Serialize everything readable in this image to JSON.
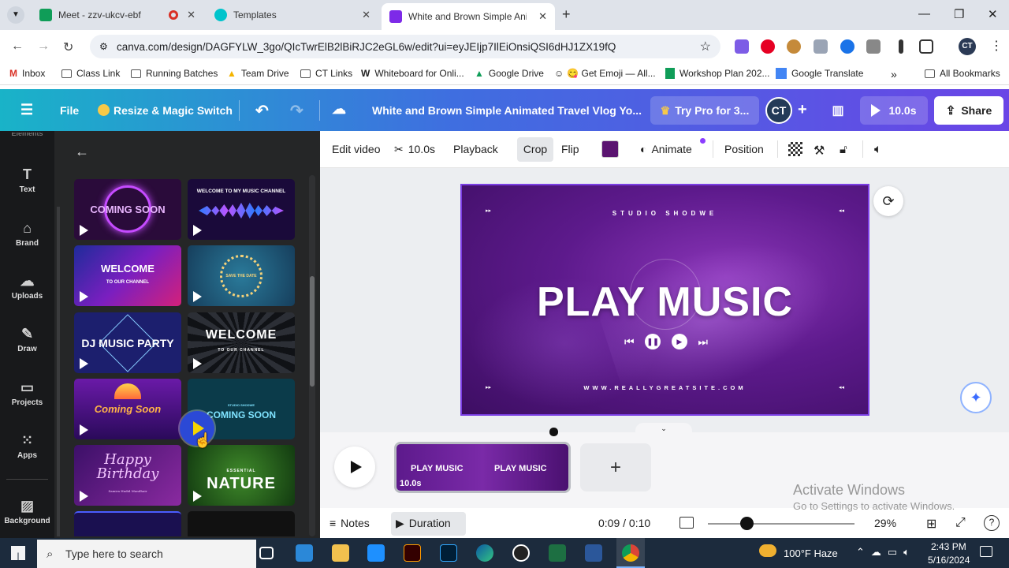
{
  "browser": {
    "tabs": [
      {
        "title": "Meet - zzv-ukcv-ebf",
        "favicon_color": "#0f9d58"
      },
      {
        "title": "Templates",
        "favicon_color": "#00c4cc"
      },
      {
        "title": "White and Brown Simple Anima",
        "favicon_color": "#7d2ae8"
      }
    ],
    "url": "canva.com/design/DAGFYLW_3go/QIcTwrElB2lBiRJC2eGL6w/edit?ui=eyJEIjp7IlEiOnsiQSI6dHJ1ZX19fQ",
    "profile": "CT",
    "bookmarks": [
      "Inbox",
      "Class Link",
      "Running Batches",
      "Team Drive",
      "CT Links",
      "Whiteboard for Onli...",
      "Google Drive",
      "😋 Get Emoji — All...",
      "Workshop Plan 202...",
      "Google Translate",
      "All Bookmarks"
    ]
  },
  "canva_header": {
    "file": "File",
    "resize": "Resize & Magic Switch",
    "title": "White and Brown Simple Animated Travel Vlog Yo...",
    "try_pro": "Try Pro for 3...",
    "avatar": "CT",
    "duration": "10.0s",
    "share": "Share"
  },
  "rail": [
    "Text",
    "Brand",
    "Uploads",
    "Draw",
    "Projects",
    "Apps",
    "Background"
  ],
  "rail_top_partial": "Elements",
  "templates": [
    {
      "label": "COMING SOON",
      "top": "SILENT LINES",
      "bg": "#2a0b3a",
      "fg": "#e9b6ff"
    },
    {
      "label": "WELCOME TO MY MUSIC CHANNEL",
      "bg": "#1a0a3a",
      "fg": "#ffffff"
    },
    {
      "label": "WELCOME",
      "sub": "TO OUR CHANNEL",
      "bg": "#3b1a7a",
      "fg": "#ffffff"
    },
    {
      "label": "SAVE THE DATE",
      "bg": "#1d5c7a",
      "fg": "#f4d27a"
    },
    {
      "label": "DJ MUSIC PARTY",
      "bg": "#1c1f6e",
      "fg": "#ffffff"
    },
    {
      "label": "WELCOME",
      "sub": "TO OUR CHANNEL",
      "bg": "#101216",
      "fg": "#ffffff"
    },
    {
      "label": "Coming Soon",
      "bg": "#4a1a8a",
      "fg": "#ffb347"
    },
    {
      "label": "COMING SOON",
      "top": "STUDIO SHODWE",
      "bg": "#0b3b4a",
      "fg": "#7fe3ff"
    },
    {
      "label": "Happy Birthday",
      "sub": "Samira Hadid Mandhair",
      "bg": "#5a1a7a",
      "fg": "#f3c6ff"
    },
    {
      "label": "NATURE",
      "sub": "ESSENTIAL",
      "bg": "#1e5a1a",
      "fg": "#ffffff"
    }
  ],
  "toolbar": {
    "edit_video": "Edit video",
    "duration": "10.0s",
    "playback": "Playback",
    "crop": "Crop",
    "flip": "Flip",
    "fill_color": "#5a1470",
    "animate": "Animate",
    "position": "Position"
  },
  "slide": {
    "top_text": "STUDIO SHODWE",
    "title": "PLAY MUSIC",
    "website": "WWW.REALLYGREATSITE.COM"
  },
  "timeline": {
    "clips": [
      {
        "text": "PLAY MUSIC",
        "duration": "10.0s"
      },
      {
        "text": "PLAY MUSIC"
      }
    ]
  },
  "footer": {
    "notes": "Notes",
    "duration_btn": "Duration",
    "time": "0:09 / 0:10",
    "zoom_pct": "29%",
    "zoom_level": 0.29
  },
  "watermark": {
    "line1": "Activate Windows",
    "line2": "Go to Settings to activate Windows."
  },
  "taskbar": {
    "search": "Type here to search",
    "weather": "100°F  Haze",
    "time": "2:43 PM",
    "date": "5/16/2024"
  }
}
